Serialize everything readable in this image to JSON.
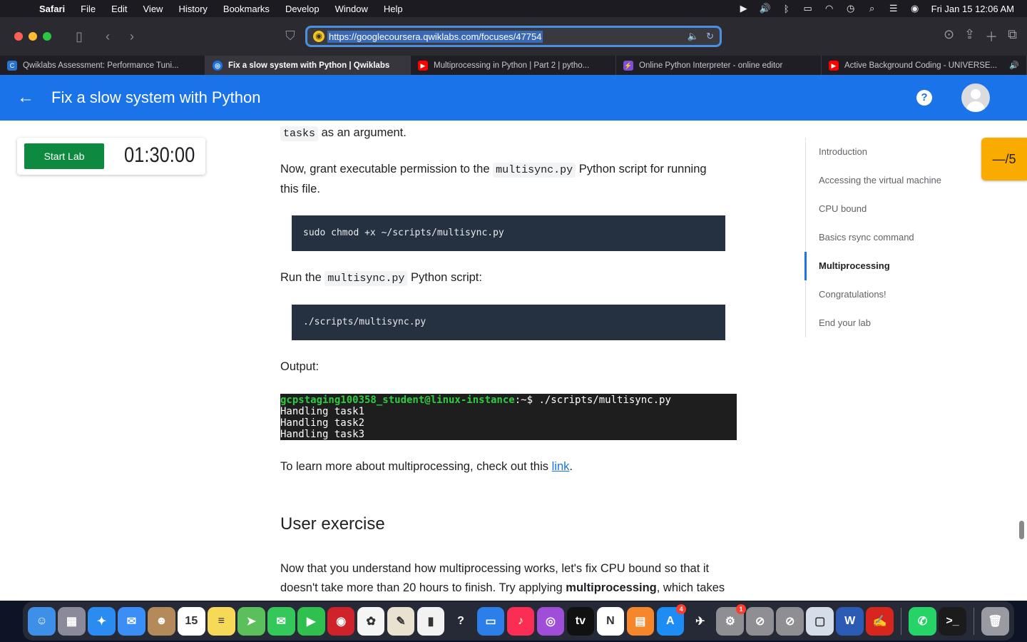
{
  "menubar": {
    "app": "Safari",
    "items": [
      "File",
      "Edit",
      "View",
      "History",
      "Bookmarks",
      "Develop",
      "Window",
      "Help"
    ],
    "clock": "Fri Jan 15  12:06 AM"
  },
  "browser": {
    "url": "https://googlecoursera.qwiklabs.com/focuses/47754",
    "tabs": [
      {
        "label": "Qwiklabs Assessment: Performance Tuni...",
        "icon": "coursera-icon",
        "color": "#2a73cc"
      },
      {
        "label": "Fix a slow system with Python | Qwiklabs",
        "icon": "qwiklabs-icon",
        "color": "#1a73e8",
        "active": true
      },
      {
        "label": "Multiprocessing in Python | Part 2 | pytho...",
        "icon": "youtube-icon",
        "color": "#ff0000"
      },
      {
        "label": "Online Python Interpreter - online editor",
        "icon": "bolt-icon",
        "color": "#7b4fd6"
      },
      {
        "label": "Active Background Coding - UNIVERSE...",
        "icon": "youtube-icon",
        "color": "#ff0000",
        "audio": true
      }
    ]
  },
  "appbar": {
    "title": "Fix a slow system with Python"
  },
  "lab": {
    "start_label": "Start Lab",
    "timer": "01:30:00",
    "score": "—/5"
  },
  "content": {
    "p0_code": "tasks",
    "p0_text": " as an argument.",
    "p1_a": "Now, grant executable permission to the ",
    "p1_code": "multisync.py",
    "p1_b": " Python script for running",
    "p1_c": "this file.",
    "code1": "sudo chmod +x ~/scripts/multisync.py",
    "p2_a": "Run the ",
    "p2_code": "multisync.py",
    "p2_b": " Python script:",
    "code2": "./scripts/multisync.py",
    "output_label": "Output:",
    "terminal": {
      "user": "gcpstaging100358_student@linux-instance",
      "prompt_rest": ":~$ ./scripts/multisync.py",
      "lines": [
        "Handling task1",
        "Handling task2",
        "Handling task3"
      ]
    },
    "p3_a": "To learn more about multiprocessing, check out this ",
    "p3_link": "link",
    "p3_b": ".",
    "section_heading": "User exercise",
    "p4_line1": "Now that you understand how multiprocessing works, let's fix CPU bound so that it",
    "p4_line2_a": "doesn't take more than 20 hours to finish. Try applying ",
    "p4_line2_bold": "multiprocessing",
    "p4_line2_b": ", which takes"
  },
  "toc": [
    {
      "label": "Introduction"
    },
    {
      "label": "Accessing the virtual machine"
    },
    {
      "label": "CPU bound"
    },
    {
      "label": "Basics rsync command"
    },
    {
      "label": "Multiprocessing",
      "active": true
    },
    {
      "label": "Congratulations!"
    },
    {
      "label": "End your lab"
    }
  ],
  "dock": {
    "apps": [
      {
        "name": "finder-icon",
        "color": "#3d8fe8",
        "glyph": "☺"
      },
      {
        "name": "launchpad-icon",
        "color": "#8a8a9a",
        "glyph": "▦"
      },
      {
        "name": "safari-icon",
        "color": "#2a8cf0",
        "glyph": "✦"
      },
      {
        "name": "mail-icon",
        "color": "#3a8ef6",
        "glyph": "✉"
      },
      {
        "name": "contacts-icon",
        "color": "#b58a5a",
        "glyph": "☻"
      },
      {
        "name": "calendar-icon",
        "color": "#ffffff",
        "glyph": "15",
        "dark": true
      },
      {
        "name": "notes-icon",
        "color": "#f7d95a",
        "glyph": "≡",
        "dark": true
      },
      {
        "name": "maps-icon",
        "color": "#5bbf5b",
        "glyph": "➤"
      },
      {
        "name": "messages-icon",
        "color": "#34c759",
        "glyph": "✉"
      },
      {
        "name": "facetime-icon",
        "color": "#30c04f",
        "glyph": "▶"
      },
      {
        "name": "photobooth-icon",
        "color": "#d0222a",
        "glyph": "◉"
      },
      {
        "name": "photos-icon",
        "color": "#f5f5f5",
        "glyph": "✿",
        "dark": true
      },
      {
        "name": "preview-icon",
        "color": "#e9e2d0",
        "glyph": "✎",
        "dark": true
      },
      {
        "name": "numbers-icon",
        "color": "#f2f2f2",
        "glyph": "▮",
        "dark": true
      },
      {
        "name": "help-icon",
        "color": "transparent",
        "glyph": "?"
      },
      {
        "name": "keynote-icon",
        "color": "#2c7fe8",
        "glyph": "▭"
      },
      {
        "name": "music-icon",
        "color": "#fa2d55",
        "glyph": "♪"
      },
      {
        "name": "podcasts-icon",
        "color": "#a04ed8",
        "glyph": "◎"
      },
      {
        "name": "tv-icon",
        "color": "#111111",
        "glyph": "tv"
      },
      {
        "name": "news-icon",
        "color": "#ffffff",
        "glyph": "N",
        "dark": true
      },
      {
        "name": "books-icon",
        "color": "#f5872a",
        "glyph": "▤"
      },
      {
        "name": "appstore-icon",
        "color": "#1d8cf5",
        "glyph": "A",
        "badge": "4"
      },
      {
        "name": "rocket-icon",
        "color": "transparent",
        "glyph": "✈"
      },
      {
        "name": "system-preferences-icon",
        "color": "#8e8e93",
        "glyph": "⚙",
        "badge": "1"
      },
      {
        "name": "blocked-app-icon",
        "color": "#8e8e93",
        "glyph": "⊘"
      },
      {
        "name": "excel-blocked-icon",
        "color": "#8e8e93",
        "glyph": "⊘"
      },
      {
        "name": "window-icon",
        "color": "#d4dde8",
        "glyph": "▢",
        "dark": true
      },
      {
        "name": "word-icon",
        "color": "#2b5bb5",
        "glyph": "W"
      },
      {
        "name": "acrobat-icon",
        "color": "#d7261e",
        "glyph": "✍"
      },
      {
        "name": "whatsapp-icon",
        "color": "#25d366",
        "glyph": "✆"
      },
      {
        "name": "terminal-icon",
        "color": "#1b1b1b",
        "glyph": ">_"
      },
      {
        "name": "trash-icon",
        "color": "#9a9aa2",
        "glyph": "🗑"
      }
    ]
  }
}
